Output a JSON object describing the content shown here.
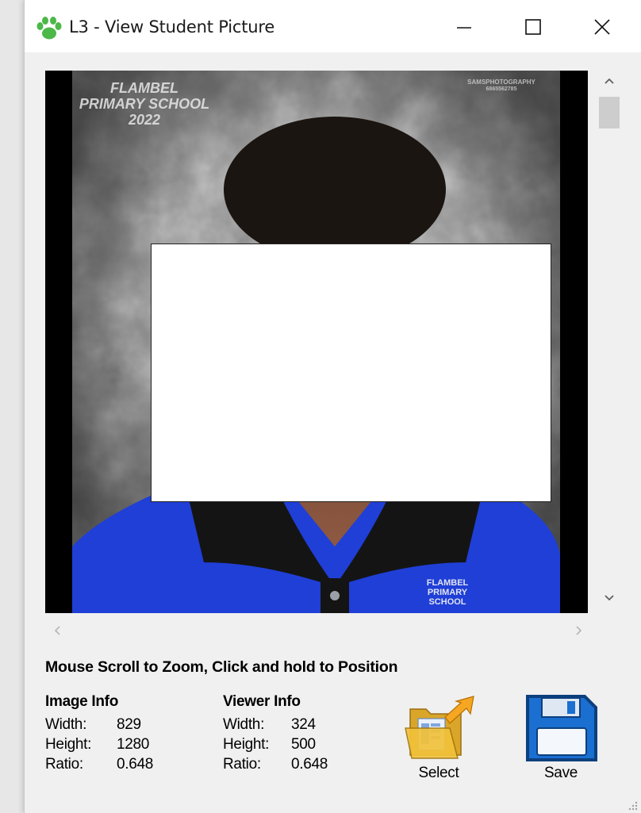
{
  "window": {
    "title": "L3 - View Student Picture",
    "icon": "paw-icon"
  },
  "controls": {
    "minimize_icon": "minimize-icon",
    "maximize_icon": "maximize-icon",
    "close_icon": "close-icon"
  },
  "photo": {
    "watermark_school": "FLAMBEL PRIMARY SCHOOL 2022",
    "watermark_photographer_line1": "SAMSPHOTOGRAPHY",
    "watermark_photographer_line2": "6865562785",
    "shirt_logo_line1": "FLAMBEL",
    "shirt_logo_line2": "PRIMARY SCHOOL"
  },
  "instruction": "Mouse Scroll to Zoom, Click and hold to Position",
  "image_info": {
    "heading": "Image Info",
    "width_label": "Width:",
    "width_value": "829",
    "height_label": "Height:",
    "height_value": "1280",
    "ratio_label": "Ratio:",
    "ratio_value": "0.648"
  },
  "viewer_info": {
    "heading": "Viewer Info",
    "width_label": "Width:",
    "width_value": "324",
    "height_label": "Height:",
    "height_value": "500",
    "ratio_label": "Ratio:",
    "ratio_value": "0.648"
  },
  "buttons": {
    "select_label": "Select",
    "save_label": "Save"
  },
  "colors": {
    "shirt_blue": "#1f3fd6",
    "collar_black": "#141414",
    "accent_save": "#1a6fd1"
  }
}
